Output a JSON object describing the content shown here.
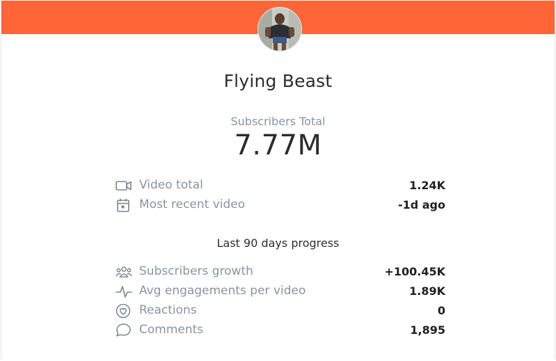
{
  "colors": {
    "banner": "#ff6536",
    "label": "#8a93a0",
    "value": "#1f1f1f"
  },
  "channel": {
    "name": "Flying Beast"
  },
  "subscribers": {
    "label": "Subscribers Total",
    "total": "7.77M"
  },
  "overview": [
    {
      "icon": "video-camera-icon",
      "label": "Video total",
      "value": "1.24K"
    },
    {
      "icon": "calendar-icon",
      "label": "Most recent video",
      "value": "-1d ago"
    }
  ],
  "progress": {
    "title": "Last 90 days progress",
    "rows": [
      {
        "icon": "users-group-icon",
        "label": "Subscribers growth",
        "value": "+100.45K"
      },
      {
        "icon": "activity-pulse-icon",
        "label": "Avg engagements per video",
        "value": "1.89K"
      },
      {
        "icon": "heart-circle-icon",
        "label": "Reactions",
        "value": "0"
      },
      {
        "icon": "comment-bubble-icon",
        "label": "Comments",
        "value": "1,895"
      }
    ]
  }
}
